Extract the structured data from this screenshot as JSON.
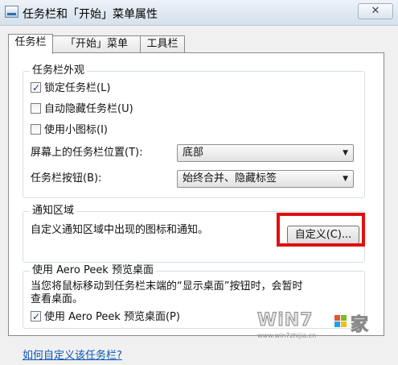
{
  "window": {
    "title": "任务栏和「开始」菜单属性",
    "close_glyph": "✕"
  },
  "tabs": [
    {
      "label": "任务栏"
    },
    {
      "label": "「开始」菜单"
    },
    {
      "label": "工具栏"
    }
  ],
  "appearance": {
    "title": "任务栏外观",
    "lock": {
      "label": "锁定任务栏(L)",
      "checked": true
    },
    "autohide": {
      "label": "自动隐藏任务栏(U)",
      "checked": false
    },
    "small_icons": {
      "label": "使用小图标(I)",
      "checked": false
    },
    "position": {
      "label": "屏幕上的任务栏位置(T):",
      "value": "底部"
    },
    "buttons": {
      "label": "任务栏按钮(B):",
      "value": "始终合并、隐藏标签"
    }
  },
  "notification": {
    "title": "通知区域",
    "description": "自定义通知区域中出现的图标和通知。",
    "customize_button": "自定义(C)..."
  },
  "aero_peek": {
    "title": "使用 Aero Peek 预览桌面",
    "description_line1": "当您将鼠标移动到任务栏末端的“显示桌面”按钮时，会暂时",
    "description_line2": "查看桌面。",
    "checkbox": {
      "label": "使用 Aero Peek 预览桌面(P)",
      "checked": true
    }
  },
  "help_link": "如何自定义该任务栏?",
  "watermark": {
    "logo": "WiN7",
    "char": "家",
    "url": "www.win7zhijia.cn"
  },
  "colors": {
    "highlight": "#e10f0f",
    "link": "#0a56b8"
  }
}
